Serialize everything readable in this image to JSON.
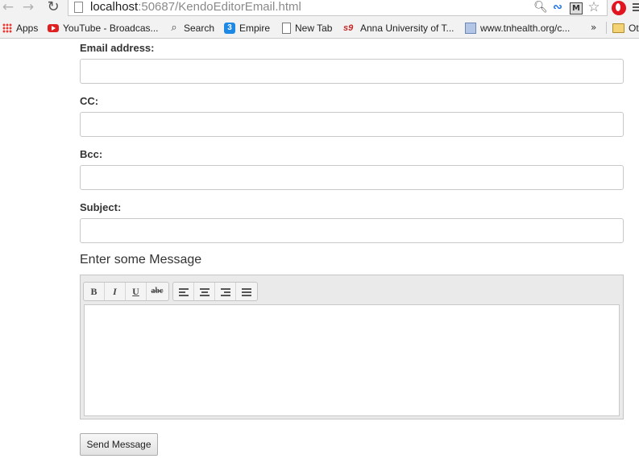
{
  "browser": {
    "url_host": "localhost",
    "url_rest": ":50687/KendoEditorEmail.html",
    "bookmarks": [
      {
        "label": "Apps",
        "icon": "apps-grid-icon"
      },
      {
        "label": "YouTube - Broadcas...",
        "icon": "youtube-icon"
      },
      {
        "label": "Search",
        "icon": "search-icon"
      },
      {
        "label": "Empire",
        "icon": "empire-icon"
      },
      {
        "label": "New Tab",
        "icon": "page-icon"
      },
      {
        "label": "Anna University of T...",
        "icon": "s9-icon"
      },
      {
        "label": "www.tnhealth.org/c...",
        "icon": "tnhealth-icon"
      },
      {
        "label": "Ot",
        "icon": "folder-icon"
      }
    ],
    "overflow_label": "»"
  },
  "form": {
    "email_label": "Email address:",
    "email_value": "",
    "cc_label": "CC:",
    "cc_value": "",
    "bcc_label": "Bcc:",
    "bcc_value": "",
    "subject_label": "Subject:",
    "subject_value": "",
    "message_heading": "Enter some Message",
    "editor_tools": {
      "bold": "B",
      "italic": "I",
      "underline": "U",
      "strikethrough": "abc"
    },
    "send_label": "Send Message"
  },
  "colors": {
    "accent_blue": "#1e88e5",
    "opera_red": "#e0151f",
    "youtube_red": "#e02020"
  }
}
